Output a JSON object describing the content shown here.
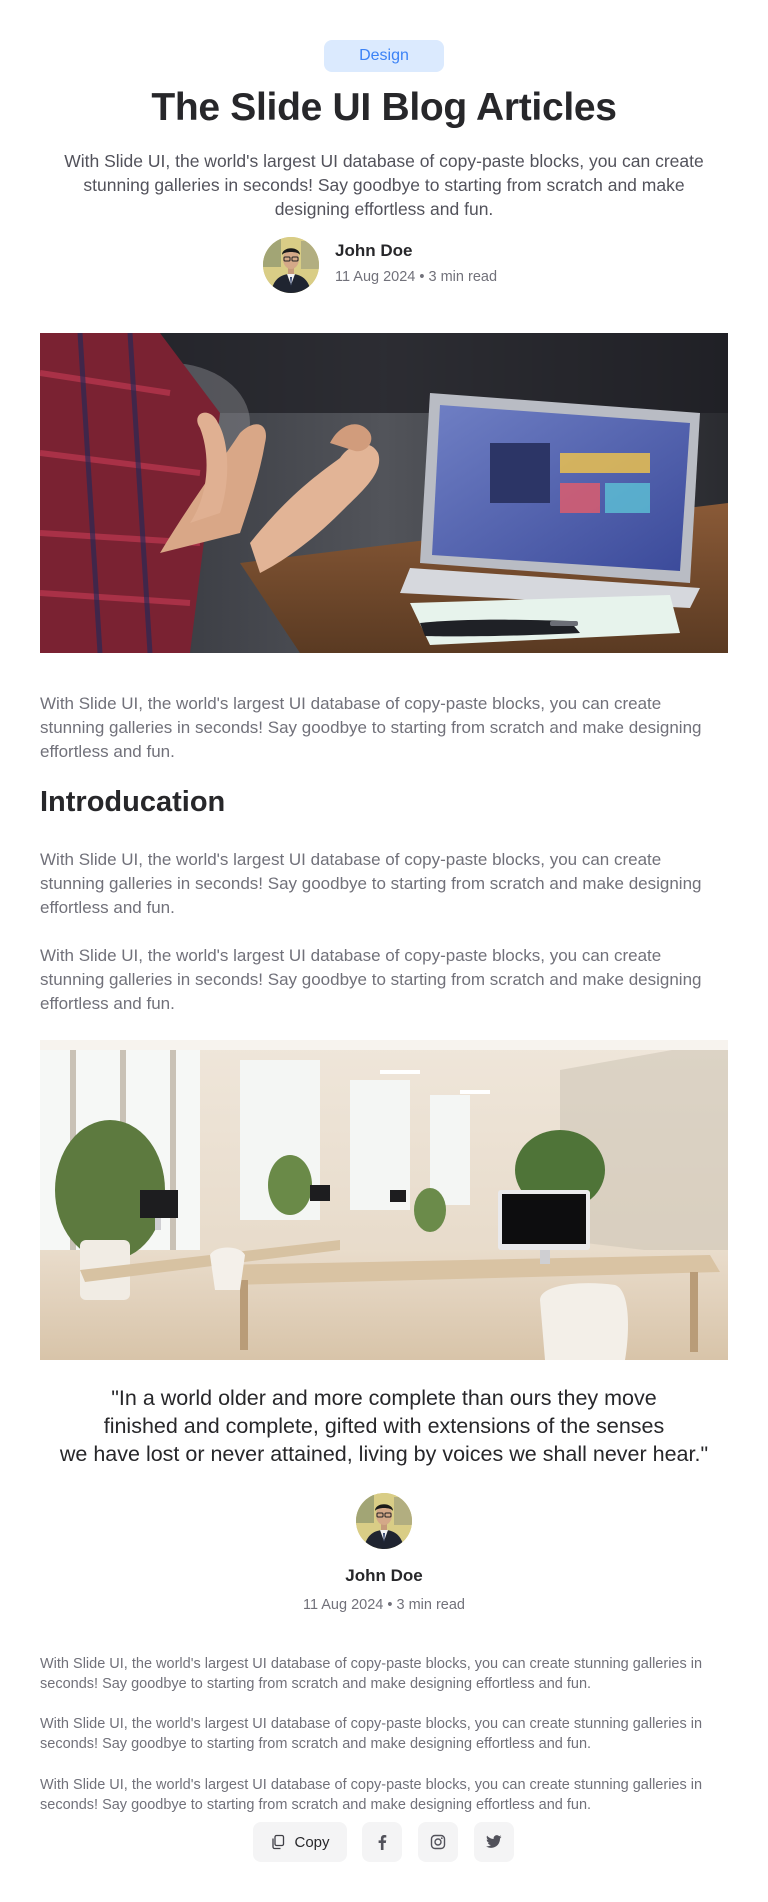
{
  "category_badge": "Design",
  "title": "The Slide UI Blog Articles",
  "subtitle": "With Slide UI, the world's largest UI database of copy-paste blocks, you can create stunning galleries in seconds! Say goodbye to starting from scratch and make designing effortless and fun.",
  "author": {
    "name": "John Doe",
    "meta": "11 Aug 2024 • 3 min read"
  },
  "body": {
    "intro_paragraph": "With Slide UI, the world's largest UI database of copy-paste blocks, you can create stunning galleries in seconds! Say goodbye to starting from scratch and make designing effortless and fun.",
    "section_heading": "Introducation",
    "paragraphs": [
      "With Slide UI, the world's largest UI database of copy-paste blocks, you can create stunning galleries in seconds! Say goodbye to starting from scratch and make designing effortless and fun.",
      "With Slide UI, the world's largest UI database of copy-paste blocks, you can create stunning galleries in seconds! Say goodbye to starting from scratch and make designing effortless and fun."
    ]
  },
  "quote": {
    "lines": [
      "\"In a world older and more complete than ours they move",
      "finished and complete, gifted with extensions of the senses",
      "we have lost or never attained, living by voices we shall never hear.\""
    ],
    "author_name": "John Doe",
    "author_meta": "11 Aug 2024 • 3 min read"
  },
  "closing_paragraphs": [
    "With Slide UI, the world's largest UI database of copy-paste blocks, you can create stunning galleries in seconds! Say goodbye to starting from scratch and make designing effortless and fun.",
    "With Slide UI, the world's largest UI database of copy-paste blocks, you can create stunning galleries in seconds! Say goodbye to starting from scratch and make designing effortless and fun.",
    "With Slide UI, the world's largest UI database of copy-paste blocks, you can create stunning galleries in seconds! Say goodbye to starting from scratch and make designing effortless and fun."
  ],
  "share": {
    "copy_label": "Copy",
    "icons": [
      "copy-icon",
      "facebook-icon",
      "instagram-icon",
      "twitter-icon"
    ]
  },
  "colors": {
    "badge_bg": "#dbeafe",
    "badge_text": "#3b82f6",
    "heading": "#27272a",
    "body_text": "#71717a",
    "button_bg": "#f4f4f5"
  }
}
